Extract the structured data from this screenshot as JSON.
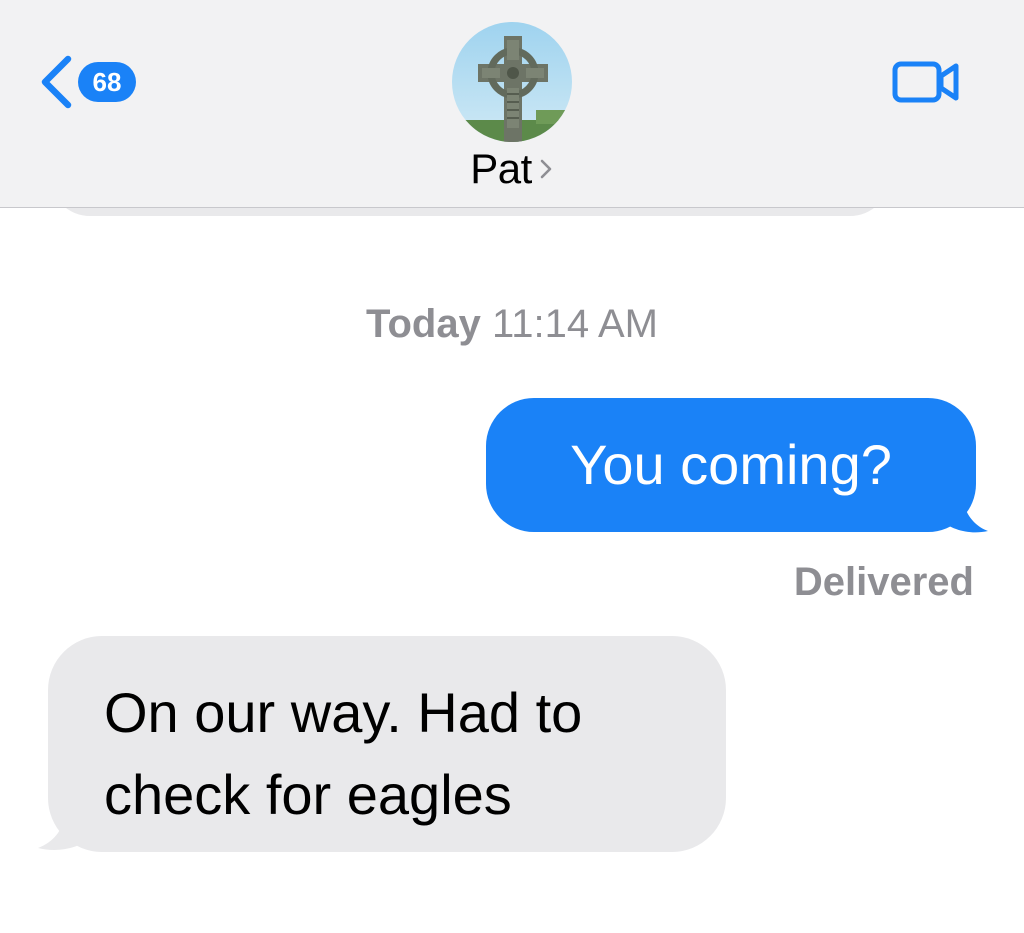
{
  "header": {
    "back_count": "68",
    "contact_name": "Pat",
    "icons": {
      "back": "chevron-left-icon",
      "contact_detail": "chevron-right-icon",
      "video": "video-camera-icon",
      "avatar": "celtic-cross-photo"
    }
  },
  "conversation": {
    "timestamp_day": "Today",
    "timestamp_time": "11:14 AM",
    "messages": [
      {
        "direction": "outgoing",
        "text": "You coming?",
        "status": "Delivered"
      },
      {
        "direction": "incoming",
        "text": "On our way. Had to check for eagles"
      }
    ]
  },
  "colors": {
    "accent_blue": "#1a82f7",
    "incoming_bubble": "#e9e9eb",
    "header_background": "#f2f2f3",
    "secondary_text": "#8e8e93"
  }
}
